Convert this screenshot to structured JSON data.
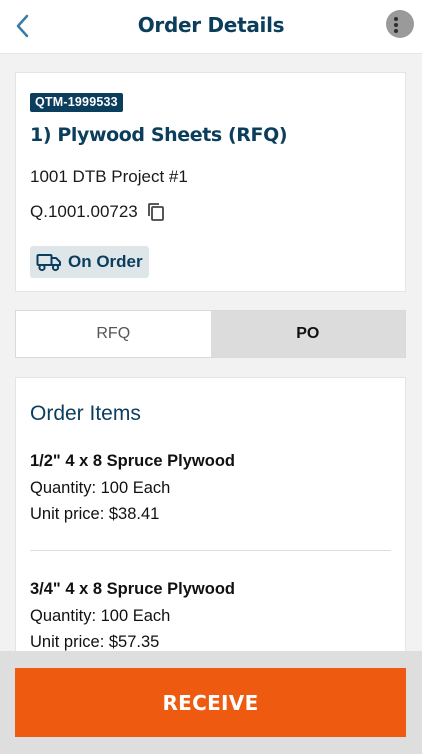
{
  "header": {
    "title": "Order Details",
    "back_icon": "chevron-left-icon",
    "menu_icon": "avatar-menu-icon"
  },
  "order": {
    "badge": "QTM-1999533",
    "title": "1) Plywood Sheets (RFQ)",
    "project": "1001 DTB Project #1",
    "quote_number": "Q.1001.00723",
    "status": "On Order",
    "status_icon": "truck-icon"
  },
  "tabs": [
    {
      "label": "RFQ",
      "selected": false
    },
    {
      "label": "PO",
      "selected": true
    }
  ],
  "items_section": {
    "heading": "Order Items",
    "items": [
      {
        "name": "1/2\" 4 x 8 Spruce Plywood",
        "quantity": "Quantity: 100 Each",
        "unit_price": "Unit price: $38.41"
      },
      {
        "name": "3/4\" 4 x 8 Spruce Plywood",
        "quantity": "Quantity: 100 Each",
        "unit_price": "Unit price: $57.35"
      }
    ]
  },
  "footer": {
    "receive_label": "RECEIVE"
  },
  "colors": {
    "primary": "#0b3d5c",
    "accent": "#ee5a10",
    "background": "#f2f2f2"
  }
}
